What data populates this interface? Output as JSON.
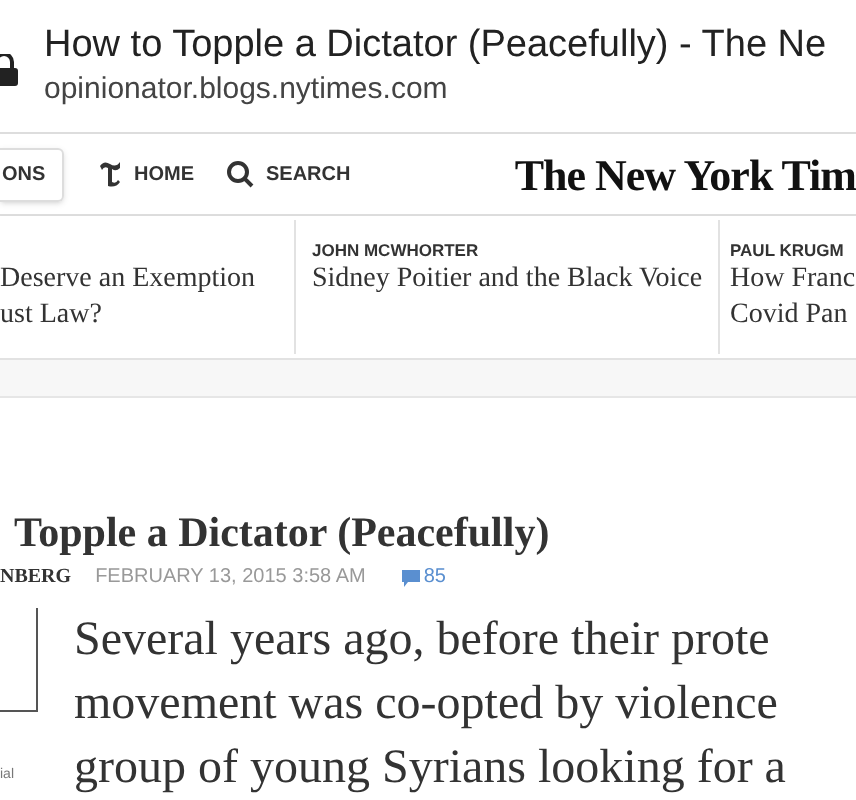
{
  "browser": {
    "title": "How to Topple a Dictator (Peacefully) - The Ne",
    "url": "opinionator.blogs.nytimes.com"
  },
  "nav": {
    "sections_button": "ONS",
    "items": [
      {
        "kind": "home",
        "label": "HOME"
      },
      {
        "kind": "search",
        "label": "SEARCH"
      }
    ],
    "logo": "The New York Tim"
  },
  "opinion_strip": [
    {
      "lines": [
        "Deserve an Exemption",
        "ust Law?"
      ]
    },
    {
      "author": "JOHN MCWHORTER",
      "lines": [
        "Sidney Poitier and the Black Voice"
      ]
    },
    {
      "author": "PAUL KRUGM",
      "lines": [
        "How Franc",
        "Covid Pan"
      ]
    }
  ],
  "article": {
    "title": "Topple a Dictator (Peacefully)",
    "byline": "NBERG",
    "date": "FEBRUARY 13, 2015 3:58 AM",
    "comments": "85",
    "caption": "ial",
    "body_lines": [
      "Several years ago, before their prote",
      "movement was co-opted by violence",
      "group of young Syrians looking for a"
    ]
  }
}
